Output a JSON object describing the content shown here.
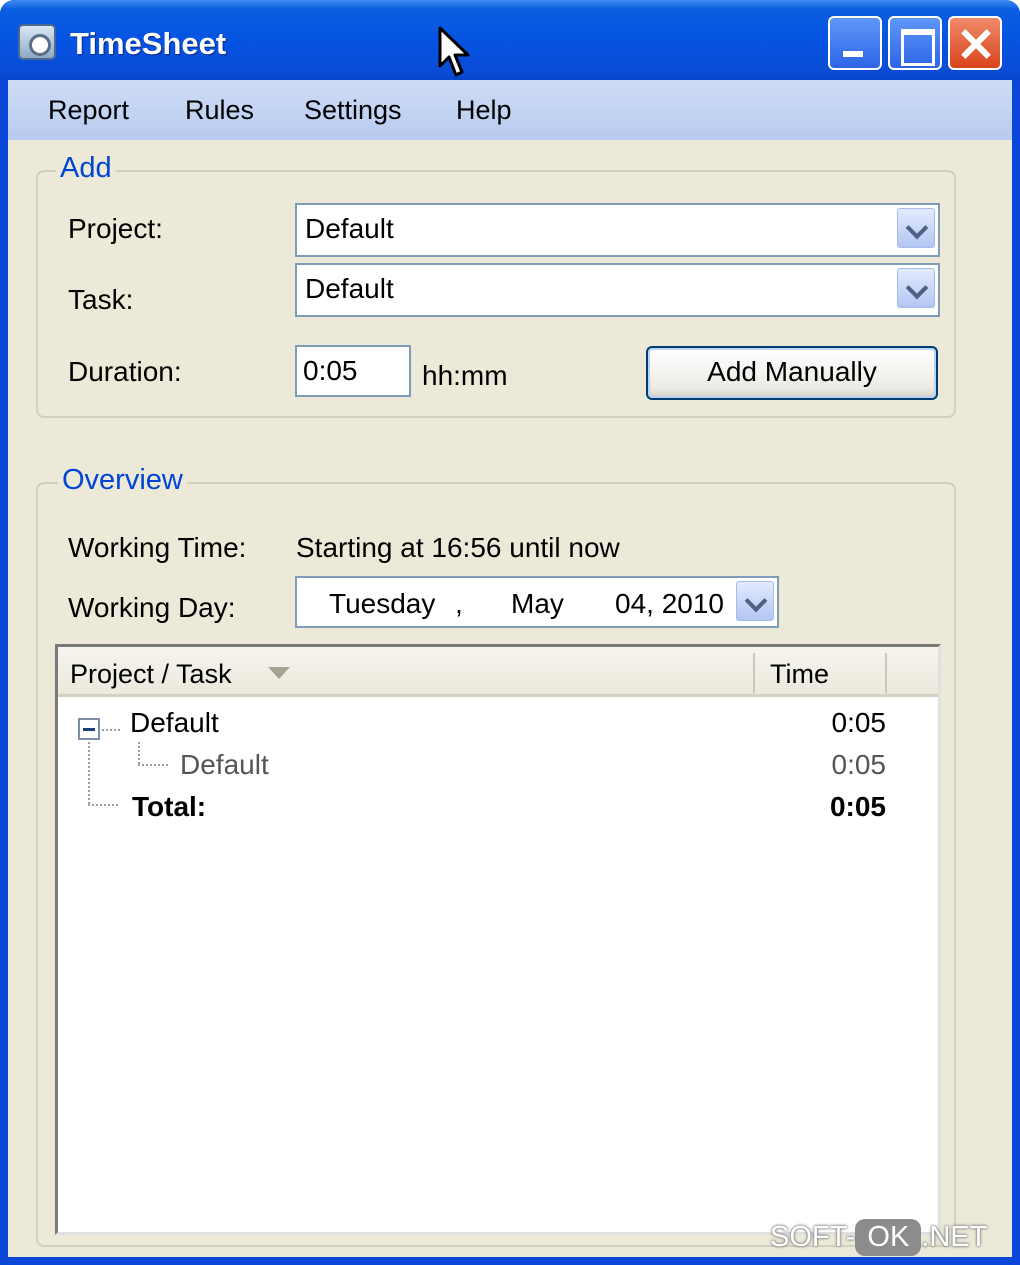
{
  "window": {
    "title": "TimeSheet"
  },
  "menu": [
    "Report",
    "Rules",
    "Settings",
    "Help"
  ],
  "add_group": {
    "label": "Add",
    "project_label": "Project:",
    "project_value": "Default",
    "task_label": "Task:",
    "task_value": "Default",
    "duration_label": "Duration:",
    "duration_value": "0:05",
    "duration_unit": "hh:mm",
    "add_button": "Add Manually"
  },
  "overview_group": {
    "label": "Overview",
    "working_time_label": "Working Time:",
    "working_time_value": "Starting at 16:56 until now",
    "working_day_label": "Working Day:",
    "date": {
      "weekday": "Tuesday",
      "separator": ",",
      "month": "May",
      "day_year": "04, 2010"
    }
  },
  "tree": {
    "columns": [
      "Project / Task",
      "Time"
    ],
    "rows": [
      {
        "label": "Default",
        "time": "0:05"
      },
      {
        "label": "Default",
        "time": "0:05"
      },
      {
        "label": "Total:",
        "time": "0:05"
      }
    ]
  },
  "watermark": {
    "prefix": "SOFT-",
    "badge": "OK",
    "suffix": ".NET"
  },
  "colors": {
    "title_bar": "#0554e3",
    "group_label": "#0046d5",
    "client_bg": "#ece9d8",
    "close_button": "#d8441d"
  }
}
